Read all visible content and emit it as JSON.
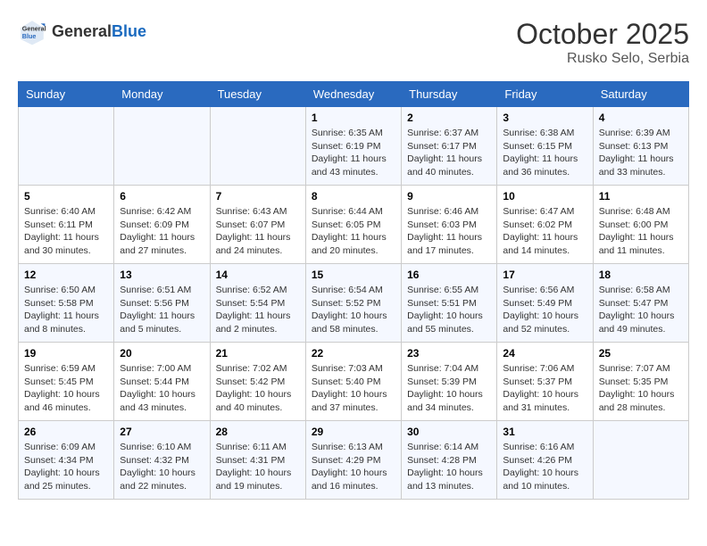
{
  "header": {
    "logo_general": "General",
    "logo_blue": "Blue",
    "month_title": "October 2025",
    "location": "Rusko Selo, Serbia"
  },
  "weekdays": [
    "Sunday",
    "Monday",
    "Tuesday",
    "Wednesday",
    "Thursday",
    "Friday",
    "Saturday"
  ],
  "weeks": [
    [
      {
        "day": "",
        "info": ""
      },
      {
        "day": "",
        "info": ""
      },
      {
        "day": "",
        "info": ""
      },
      {
        "day": "1",
        "info": "Sunrise: 6:35 AM\nSunset: 6:19 PM\nDaylight: 11 hours\nand 43 minutes."
      },
      {
        "day": "2",
        "info": "Sunrise: 6:37 AM\nSunset: 6:17 PM\nDaylight: 11 hours\nand 40 minutes."
      },
      {
        "day": "3",
        "info": "Sunrise: 6:38 AM\nSunset: 6:15 PM\nDaylight: 11 hours\nand 36 minutes."
      },
      {
        "day": "4",
        "info": "Sunrise: 6:39 AM\nSunset: 6:13 PM\nDaylight: 11 hours\nand 33 minutes."
      }
    ],
    [
      {
        "day": "5",
        "info": "Sunrise: 6:40 AM\nSunset: 6:11 PM\nDaylight: 11 hours\nand 30 minutes."
      },
      {
        "day": "6",
        "info": "Sunrise: 6:42 AM\nSunset: 6:09 PM\nDaylight: 11 hours\nand 27 minutes."
      },
      {
        "day": "7",
        "info": "Sunrise: 6:43 AM\nSunset: 6:07 PM\nDaylight: 11 hours\nand 24 minutes."
      },
      {
        "day": "8",
        "info": "Sunrise: 6:44 AM\nSunset: 6:05 PM\nDaylight: 11 hours\nand 20 minutes."
      },
      {
        "day": "9",
        "info": "Sunrise: 6:46 AM\nSunset: 6:03 PM\nDaylight: 11 hours\nand 17 minutes."
      },
      {
        "day": "10",
        "info": "Sunrise: 6:47 AM\nSunset: 6:02 PM\nDaylight: 11 hours\nand 14 minutes."
      },
      {
        "day": "11",
        "info": "Sunrise: 6:48 AM\nSunset: 6:00 PM\nDaylight: 11 hours\nand 11 minutes."
      }
    ],
    [
      {
        "day": "12",
        "info": "Sunrise: 6:50 AM\nSunset: 5:58 PM\nDaylight: 11 hours\nand 8 minutes."
      },
      {
        "day": "13",
        "info": "Sunrise: 6:51 AM\nSunset: 5:56 PM\nDaylight: 11 hours\nand 5 minutes."
      },
      {
        "day": "14",
        "info": "Sunrise: 6:52 AM\nSunset: 5:54 PM\nDaylight: 11 hours\nand 2 minutes."
      },
      {
        "day": "15",
        "info": "Sunrise: 6:54 AM\nSunset: 5:52 PM\nDaylight: 10 hours\nand 58 minutes."
      },
      {
        "day": "16",
        "info": "Sunrise: 6:55 AM\nSunset: 5:51 PM\nDaylight: 10 hours\nand 55 minutes."
      },
      {
        "day": "17",
        "info": "Sunrise: 6:56 AM\nSunset: 5:49 PM\nDaylight: 10 hours\nand 52 minutes."
      },
      {
        "day": "18",
        "info": "Sunrise: 6:58 AM\nSunset: 5:47 PM\nDaylight: 10 hours\nand 49 minutes."
      }
    ],
    [
      {
        "day": "19",
        "info": "Sunrise: 6:59 AM\nSunset: 5:45 PM\nDaylight: 10 hours\nand 46 minutes."
      },
      {
        "day": "20",
        "info": "Sunrise: 7:00 AM\nSunset: 5:44 PM\nDaylight: 10 hours\nand 43 minutes."
      },
      {
        "day": "21",
        "info": "Sunrise: 7:02 AM\nSunset: 5:42 PM\nDaylight: 10 hours\nand 40 minutes."
      },
      {
        "day": "22",
        "info": "Sunrise: 7:03 AM\nSunset: 5:40 PM\nDaylight: 10 hours\nand 37 minutes."
      },
      {
        "day": "23",
        "info": "Sunrise: 7:04 AM\nSunset: 5:39 PM\nDaylight: 10 hours\nand 34 minutes."
      },
      {
        "day": "24",
        "info": "Sunrise: 7:06 AM\nSunset: 5:37 PM\nDaylight: 10 hours\nand 31 minutes."
      },
      {
        "day": "25",
        "info": "Sunrise: 7:07 AM\nSunset: 5:35 PM\nDaylight: 10 hours\nand 28 minutes."
      }
    ],
    [
      {
        "day": "26",
        "info": "Sunrise: 6:09 AM\nSunset: 4:34 PM\nDaylight: 10 hours\nand 25 minutes."
      },
      {
        "day": "27",
        "info": "Sunrise: 6:10 AM\nSunset: 4:32 PM\nDaylight: 10 hours\nand 22 minutes."
      },
      {
        "day": "28",
        "info": "Sunrise: 6:11 AM\nSunset: 4:31 PM\nDaylight: 10 hours\nand 19 minutes."
      },
      {
        "day": "29",
        "info": "Sunrise: 6:13 AM\nSunset: 4:29 PM\nDaylight: 10 hours\nand 16 minutes."
      },
      {
        "day": "30",
        "info": "Sunrise: 6:14 AM\nSunset: 4:28 PM\nDaylight: 10 hours\nand 13 minutes."
      },
      {
        "day": "31",
        "info": "Sunrise: 6:16 AM\nSunset: 4:26 PM\nDaylight: 10 hours\nand 10 minutes."
      },
      {
        "day": "",
        "info": ""
      }
    ]
  ]
}
